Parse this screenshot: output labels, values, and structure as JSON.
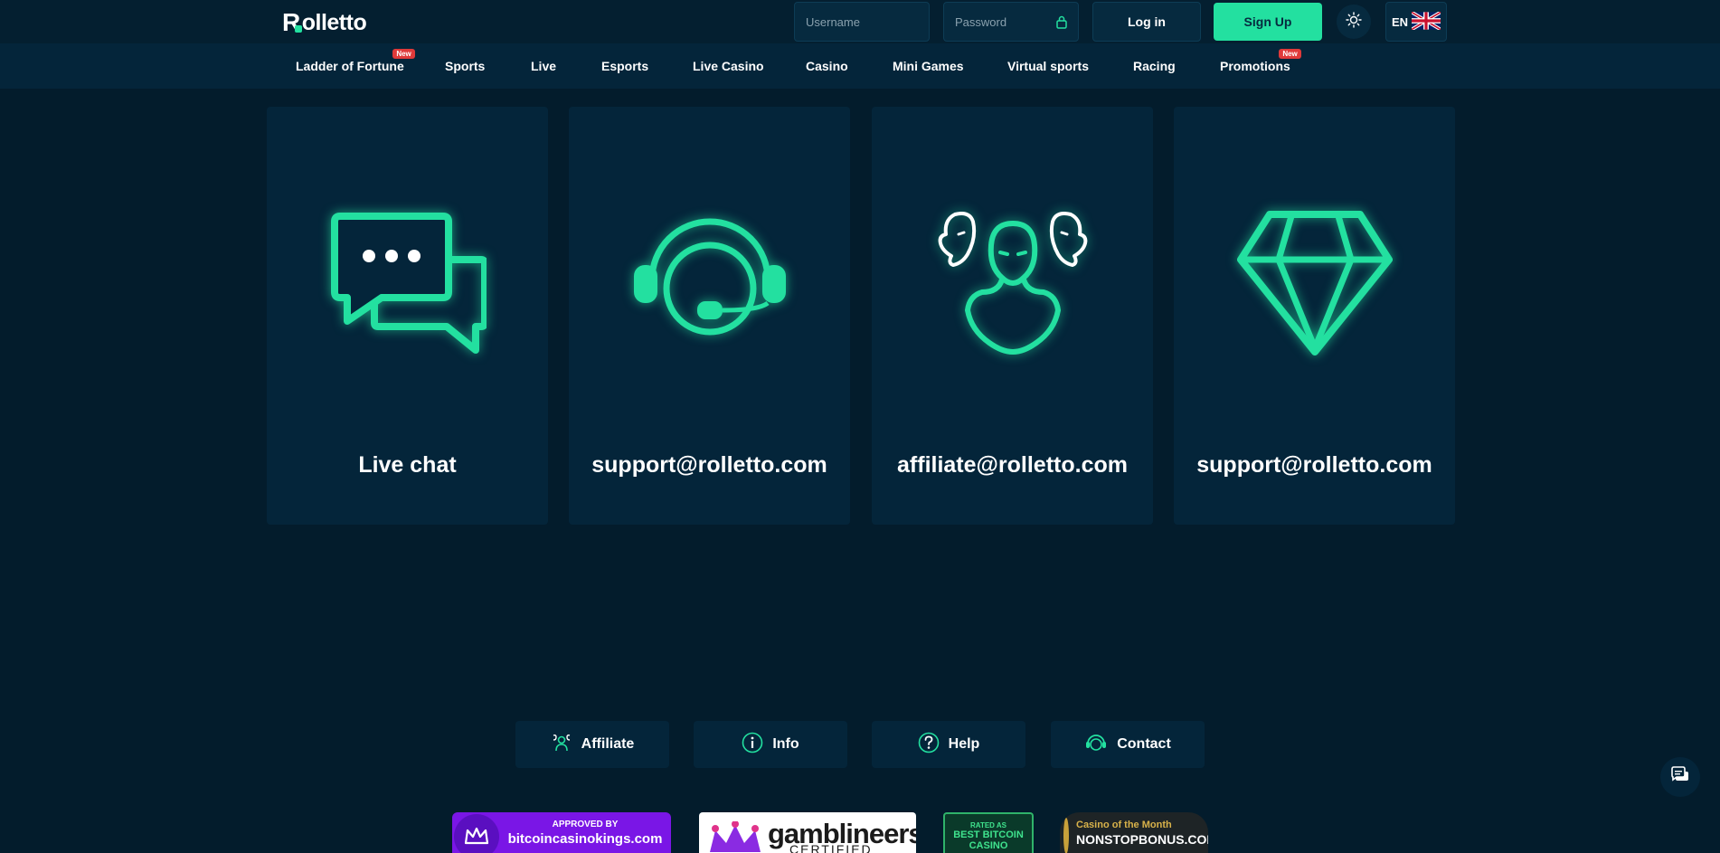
{
  "header": {
    "logo_text": "olletto",
    "logo_initial": "R",
    "username_placeholder": "Username",
    "password_placeholder": "Password",
    "login_label": "Log in",
    "signup_label": "Sign Up",
    "language_code": "EN"
  },
  "nav": {
    "items": [
      {
        "label": "Ladder of Fortune",
        "badge": "New"
      },
      {
        "label": "Sports"
      },
      {
        "label": "Live"
      },
      {
        "label": "Esports"
      },
      {
        "label": "Live Casino"
      },
      {
        "label": "Casino"
      },
      {
        "label": "Mini Games"
      },
      {
        "label": "Virtual sports"
      },
      {
        "label": "Racing"
      },
      {
        "label": "Promotions",
        "badge": "New"
      }
    ]
  },
  "contact_cards": [
    {
      "icon": "chat-bubbles-icon",
      "label": "Live chat"
    },
    {
      "icon": "headset-icon",
      "label": "support@rolletto.com"
    },
    {
      "icon": "affiliate-people-icon",
      "label": "affiliate@rolletto.com"
    },
    {
      "icon": "diamond-icon",
      "label": "support@rolletto.com"
    }
  ],
  "footer_nav": [
    {
      "icon": "affiliate-icon",
      "label": "Affiliate"
    },
    {
      "icon": "info-icon",
      "label": "Info"
    },
    {
      "icon": "help-icon",
      "label": "Help"
    },
    {
      "icon": "contact-icon",
      "label": "Contact"
    }
  ],
  "trust_badges": {
    "kings": {
      "line1": "APPROVED BY",
      "line2": "bitcoincasinokings.com"
    },
    "gamblineers": {
      "line1": "gamblineers",
      "line2": "CERTIFIED"
    },
    "rated": {
      "line1": "RATED AS",
      "line2": "BEST BITCOIN",
      "line3": "CASINO"
    },
    "nonstop": {
      "line1": "Casino of the Month",
      "line2": "NONSTOPBONUS.COM"
    }
  },
  "colors": {
    "background": "#031c2c",
    "card": "#04253a",
    "accent": "#23e0a0",
    "badge_red": "#e03a3a"
  }
}
